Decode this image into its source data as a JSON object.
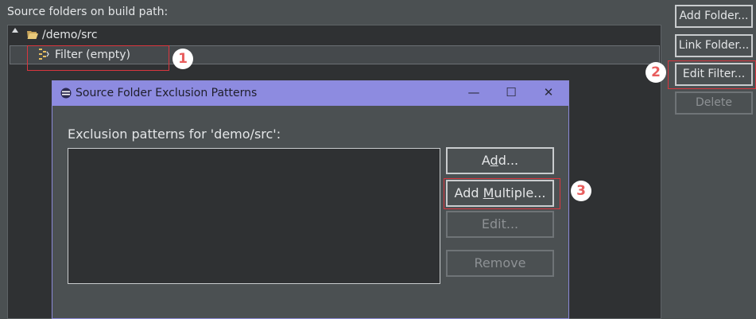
{
  "build_path": {
    "section_label": "Source folders on build path:",
    "tree": {
      "root_label": "/demo/src",
      "child_label": "Filter (empty)"
    },
    "buttons": {
      "add_folder": "Add Folder...",
      "link_folder": "Link Folder...",
      "edit_filter": "Edit Filter...",
      "delete": "Delete"
    }
  },
  "callouts": [
    "1",
    "2",
    "3"
  ],
  "dialog": {
    "title": "Source Folder Exclusion Patterns",
    "prompt": "Exclusion patterns for 'demo/src':",
    "controls": {
      "minimize": "—",
      "maximize": "☐",
      "close": "✕"
    },
    "buttons": {
      "add_pre": "A",
      "add_mn": "d",
      "add_post": "d...",
      "add_multiple_pre": "Add ",
      "add_multiple_mn": "M",
      "add_multiple_post": "ultiple...",
      "edit": "Edit...",
      "remove": "Remove"
    }
  },
  "colors": {
    "dialog_title_bar": "#8d8be0",
    "highlight_border": "#d9363e",
    "badge_text": "#e85d5d"
  },
  "icons": [
    "tree-collapse-arrow-icon",
    "folder-open-icon",
    "filter-icon",
    "dialog-app-icon"
  ]
}
